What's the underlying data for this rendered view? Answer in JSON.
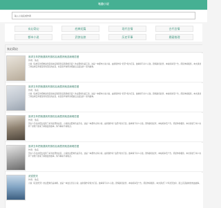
{
  "site": {
    "title": "笔趣小说"
  },
  "search": {
    "placeholder": "输入小说名或作者"
  },
  "nav": [
    {
      "label": "玄幻奇幻"
    },
    {
      "label": "经典短篇"
    },
    {
      "label": "现代言情"
    },
    {
      "label": "古代言情"
    },
    {
      "label": "都市小说"
    },
    {
      "label": "武侠仙侠"
    },
    {
      "label": "历史军事"
    },
    {
      "label": "悬疑推理"
    }
  ],
  "section": {
    "title": "玄幻奇幻"
  },
  "books": [
    {
      "title": "追求五年把她逼到贵族校后我居然就选我暗恋爱",
      "author": "作者：佚名",
      "intro": "小说《追求五年把她逼到贵族校后我居然就选我暗恋爱》的主要角色是江南，这是一本都市小说小说，由新锐作家“君圣”倾力打造，故事情节扣人心弦，剧情跌宕起伏，本站纯净无广告，阅读体验极佳，本文讲述了他追求五年都没得到回应的女孩，在贵族学校再次相遇之后发生的一系列故事。"
    },
    {
      "title": "追求五年把她逼到贵族校后我居然就选我暗恋爱",
      "author": "作者：佚名",
      "intro": "小说《追求五年把她逼到贵族校后我居然就选我暗恋爱》的主要角色是江南，这是一本都市小说小说，由新锐作家“君圣”倾力打造，故事情节扣人心弦，剧情跌宕起伏，本站纯净无广告，阅读体验极佳，本文讲述了他追求五年都没得到回应的女孩，在贵族学校再次相遇之后发生的一系列故事。"
    },
    {
      "title": "追求五年把她逼到贵族校后我居然就选我暗恋爱",
      "author": "作者：佚名",
      "intro": "男主人苏北在阳台发现了来到这里的女孩，小说的主要角色是苏北，这是一本都市言情小说，由新锐作家“泊酒”倾力打造，故事情节扣人心弦，剧情跌宕起伏，本站纯净无广告，阅读体验极佳，本文讲述了两人在同一屋檐下逐渐了解彼此的故事，情节精彩不容错过。"
    },
    {
      "title": "追求五年把她逼到贵族校后我居然就选我暗恋爱",
      "author": "作者：佚名",
      "intro": "男主人苏北在阳台发现了来到这里的女孩，小说的主要角色是苏北，这是一本都市言情小说，由新锐作家“泊酒”倾力打造，故事情节扣人心弦，剧情跌宕起伏，本站纯净无广告，阅读体验极佳，本文讲述了两人在同一屋檐下逐渐了解彼此的故事，情节精彩不容错过。"
    },
    {
      "title": "武逆焚天",
      "author": "作者：佚名",
      "intro": "小说《武逆焚天》的主要角色是林枫，这是一本玄幻奇幻小说，由新锐作家倾力打造，故事情节扣人心弦，剧情跌宕起伏，本站纯净无广告，阅读体验极佳，本文讲述了少年逆天改命、踏上武道巅峰的热血故事。"
    }
  ],
  "colors": {
    "accent": "#46b093",
    "link": "#3a7f6b"
  }
}
